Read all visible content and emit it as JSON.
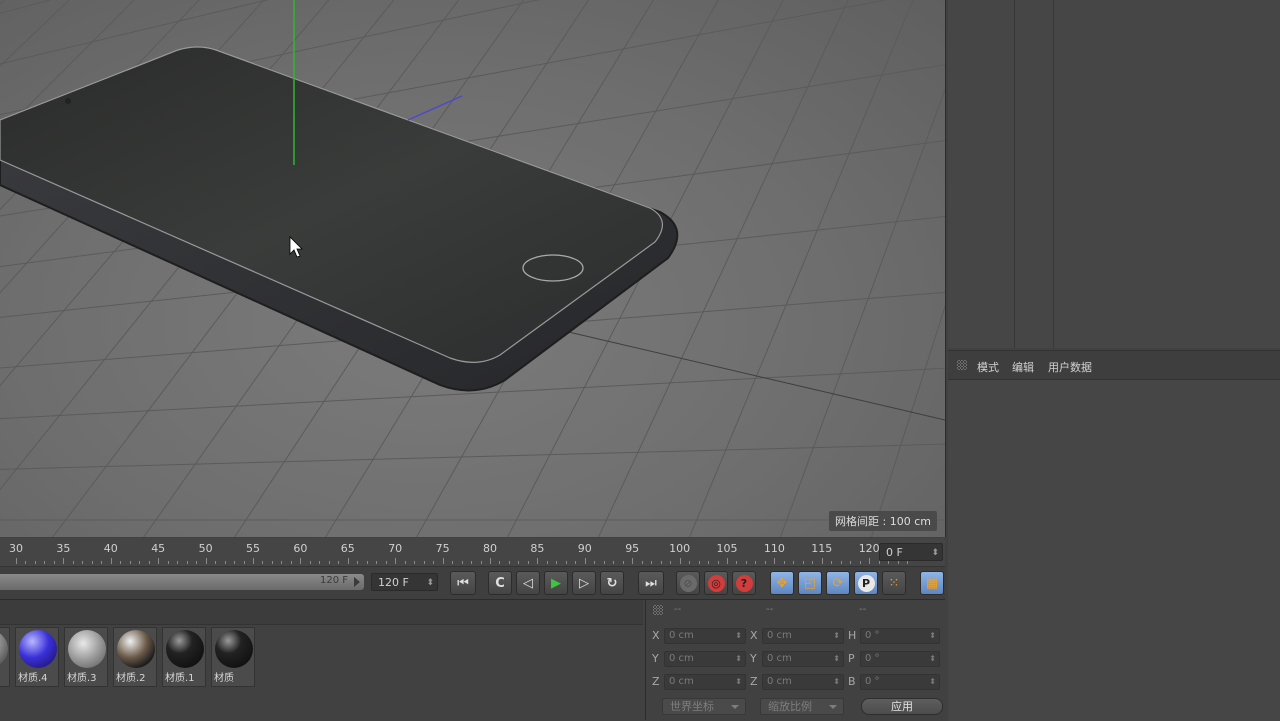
{
  "viewport": {
    "grid_spacing_label": "网格间距 : 100 cm"
  },
  "timeline": {
    "ticks": [
      "30",
      "35",
      "40",
      "45",
      "50",
      "55",
      "60",
      "65",
      "70",
      "75",
      "80",
      "85",
      "90",
      "95",
      "100",
      "105",
      "110",
      "115",
      "120"
    ],
    "current_frame": "0 F",
    "range_end_label": "120 F",
    "end_frame_field": "120 F"
  },
  "attributes": {
    "tabs": [
      "模式",
      "编辑",
      "用户数据"
    ]
  },
  "materials": [
    {
      "name": "材质.4",
      "style": "blue"
    },
    {
      "name": "材质.3",
      "style": "disco"
    },
    {
      "name": "材质.2",
      "style": "chrome"
    },
    {
      "name": "材质.1",
      "style": "black"
    },
    {
      "name": "材质",
      "style": "black"
    }
  ],
  "coordinates": {
    "headers": [
      "--",
      "--",
      "--"
    ],
    "rows": [
      {
        "l1": "X",
        "v1": "0 cm",
        "l2": "X",
        "v2": "0 cm",
        "l3": "H",
        "v3": "0 °"
      },
      {
        "l1": "Y",
        "v1": "0 cm",
        "l2": "Y",
        "v2": "0 cm",
        "l3": "P",
        "v3": "0 °"
      },
      {
        "l1": "Z",
        "v1": "0 cm",
        "l2": "Z",
        "v2": "0 cm",
        "l3": "B",
        "v3": "0 °"
      }
    ],
    "coord_mode": "世界坐标",
    "scale_mode": "缩放比例",
    "apply_label": "应用"
  },
  "colors": {
    "accent_blue": "#6f96d2",
    "play_green": "#3cc63c",
    "record_red": "#d23c3c"
  }
}
